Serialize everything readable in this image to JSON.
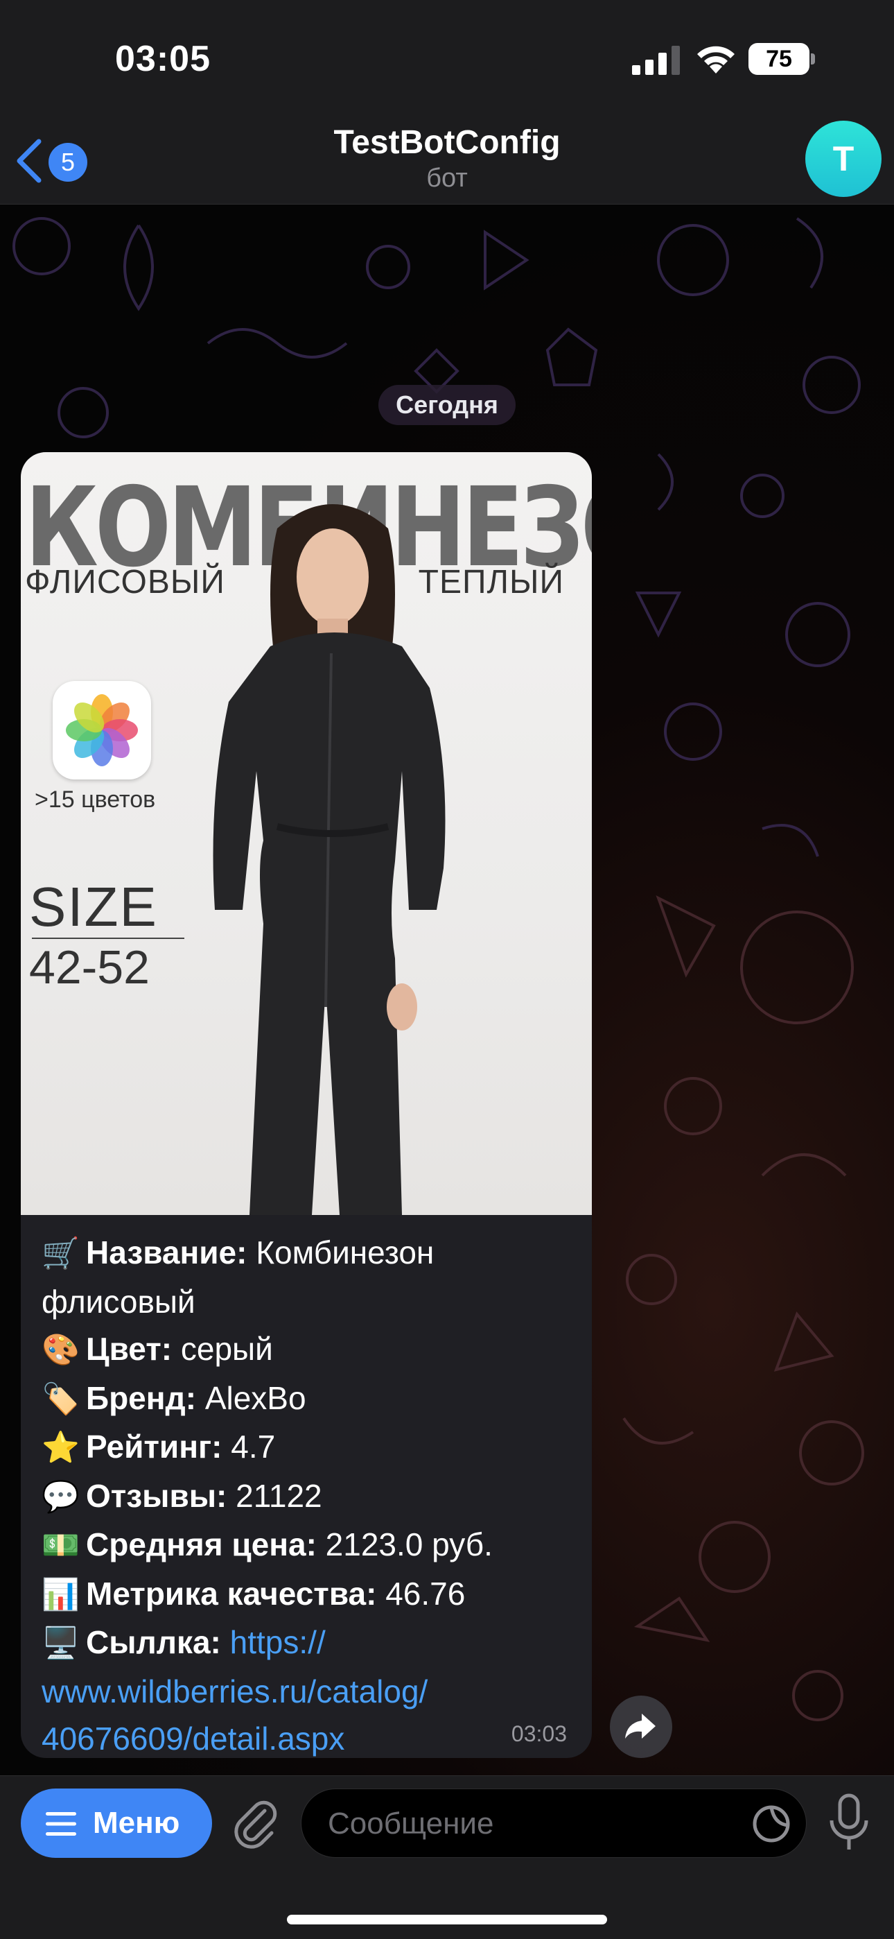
{
  "status_bar": {
    "time": "03:05",
    "battery": "75"
  },
  "header": {
    "back_badge": "5",
    "title": "TestBotConfig",
    "subtitle": "бот",
    "avatar_letter": "T"
  },
  "chat": {
    "date_chip": "Сегодня",
    "message": {
      "photo": {
        "heading": "КОМБИНЕЗОН",
        "sub_left": "ФЛИСОВЫЙ",
        "sub_right": "ТЕПЛЫЙ",
        "colors_caption": ">15 цветов",
        "size_label": "SIZE",
        "size_range": "42-52"
      },
      "lines": [
        {
          "emoji": "🛒",
          "key": "Название:",
          "value": " Комбинезон"
        },
        {
          "value": "флисовый"
        },
        {
          "emoji": "🎨",
          "key": "Цвет:",
          "value": " серый"
        },
        {
          "emoji": "🏷️",
          "key": "Бренд:",
          "value": " AlexBo"
        },
        {
          "emoji": "⭐",
          "key": "Рейтинг:",
          "value": " 4.7"
        },
        {
          "emoji": "💬",
          "key": "Отзывы:",
          "value": " 21122"
        },
        {
          "emoji": "💵",
          "key": "Средняя цена:",
          "value": " 2123.0 руб."
        },
        {
          "emoji": "📊",
          "key": "Метрика качества:",
          "value": " 46.76"
        },
        {
          "emoji": "🖥️",
          "key": "Сыллка:",
          "link": " https://"
        },
        {
          "link": "www.wildberries.ru/catalog/"
        },
        {
          "link": "40676609/detail.aspx"
        }
      ],
      "time": "03:03"
    }
  },
  "input_bar": {
    "menu_label": "Меню",
    "message_placeholder": "Сообщение"
  },
  "icons": {
    "back": "chevron-left-icon",
    "forward": "forward-arrow-icon",
    "attach": "paperclip-icon",
    "sticker": "sticker-icon",
    "mic": "microphone-icon",
    "menu": "hamburger-icon"
  },
  "colors": {
    "accent": "#3f86f5",
    "link": "#4a9ff5",
    "avatar": "#22d3d6",
    "bubble": "#1f1f24",
    "bar": "#1c1c1e"
  }
}
